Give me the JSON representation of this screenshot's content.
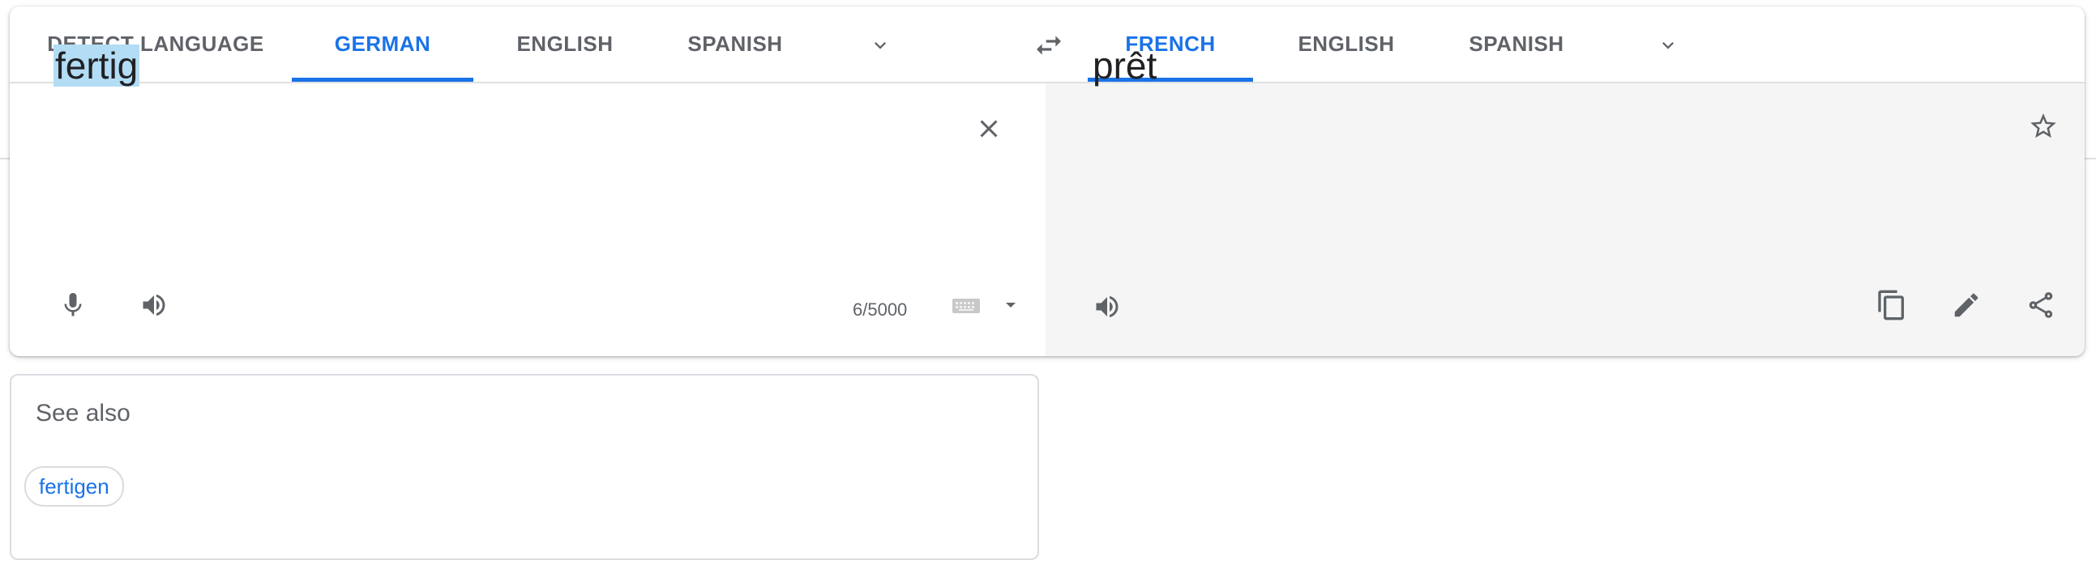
{
  "source_tabs": [
    {
      "label": "DETECT LANGUAGE",
      "active": false
    },
    {
      "label": "GERMAN",
      "active": true
    },
    {
      "label": "ENGLISH",
      "active": false
    },
    {
      "label": "SPANISH",
      "active": false
    }
  ],
  "target_tabs": [
    {
      "label": "FRENCH",
      "active": true
    },
    {
      "label": "ENGLISH",
      "active": false
    },
    {
      "label": "SPANISH",
      "active": false
    }
  ],
  "source": {
    "text": "fertig",
    "char_count": "6/5000"
  },
  "target": {
    "text": "prêt"
  },
  "see_also": {
    "title": "See also",
    "suggestions": [
      "fertigen"
    ]
  },
  "colors": {
    "accent": "#1a73e8",
    "icon": "#5f6368",
    "highlight": "#b3dcf5",
    "target_bg": "#f5f5f5"
  },
  "icons": [
    "chevron-down-icon",
    "swap-icon",
    "close-icon",
    "microphone-icon",
    "speaker-icon",
    "keyboard-icon",
    "caret-down-icon",
    "star-icon",
    "copy-icon",
    "pencil-icon",
    "share-icon"
  ]
}
